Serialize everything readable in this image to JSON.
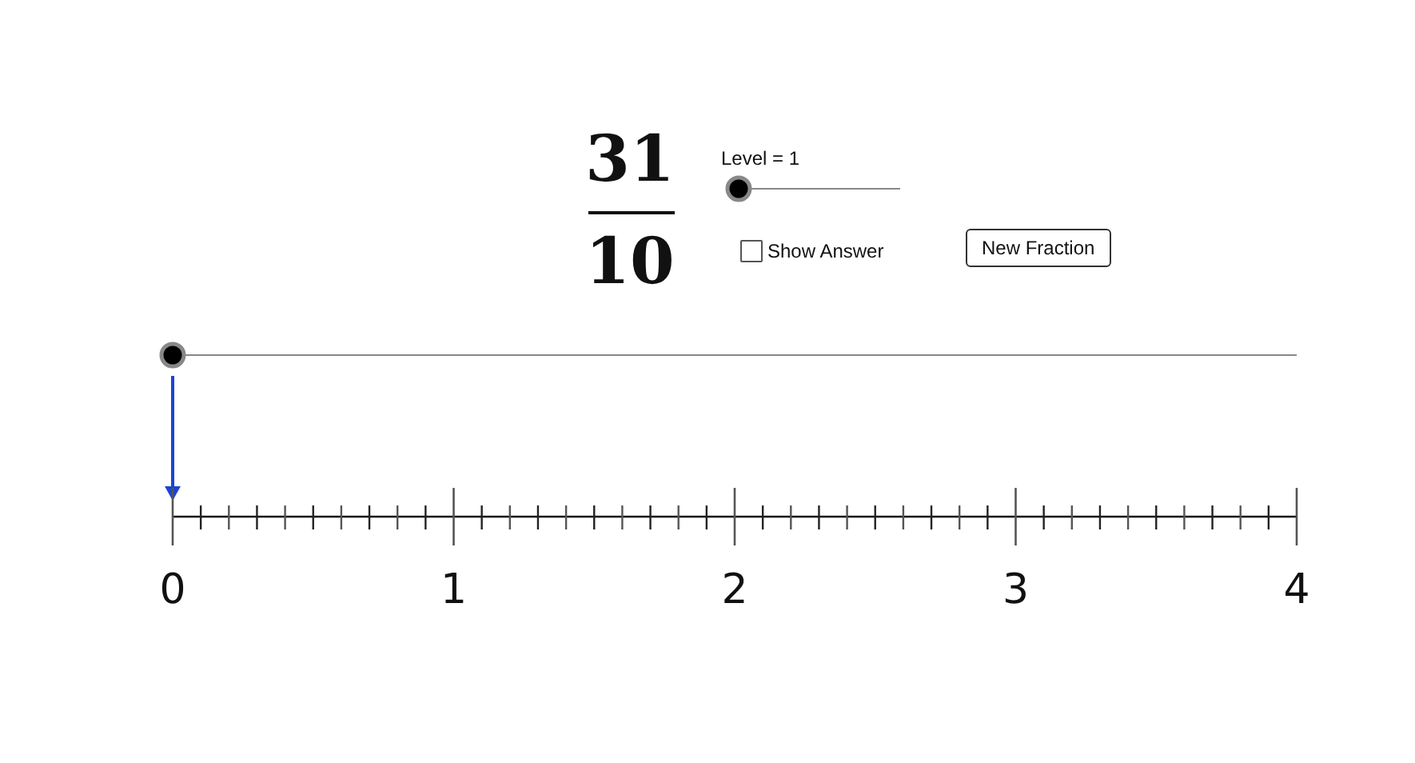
{
  "fraction": {
    "numerator": "31",
    "denominator": "10"
  },
  "level_slider": {
    "label": "Level = 1",
    "level": 0
  },
  "show_answer": {
    "label": "Show Answer",
    "checked": false
  },
  "new_fraction_button": {
    "label": "New Fraction"
  },
  "point_slider": {
    "level": 0
  },
  "number_line": {
    "labels": [
      "0",
      "1",
      "2",
      "3",
      "4"
    ]
  }
}
